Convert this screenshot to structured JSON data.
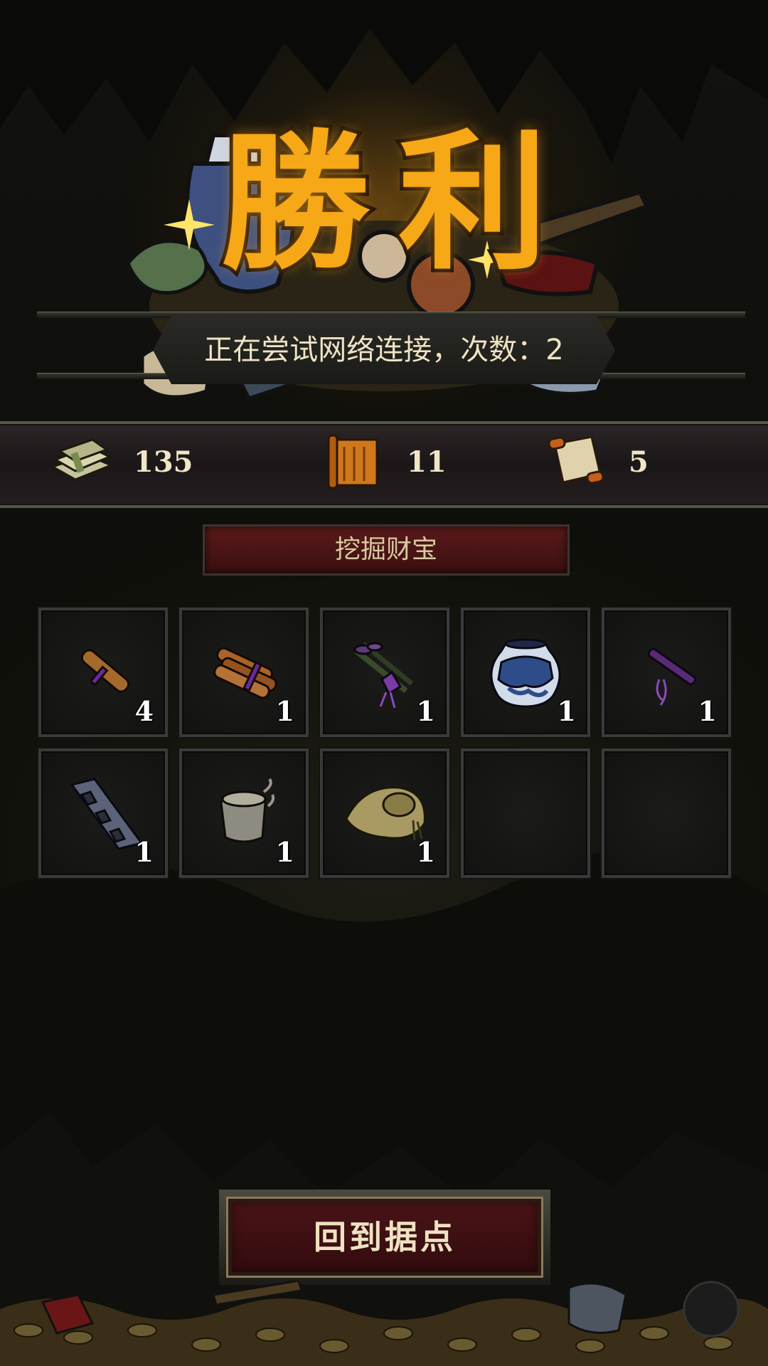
{
  "title": "勝利",
  "network_status": "正在尝试网络连接，次数：2",
  "resources": [
    {
      "icon": "money-icon",
      "value": "135"
    },
    {
      "icon": "scroll-icon",
      "value": "11"
    },
    {
      "icon": "map-icon",
      "value": "5"
    }
  ],
  "section_title": "挖掘财宝",
  "loot": [
    {
      "icon": "wood-bundle-icon",
      "count": "4"
    },
    {
      "icon": "wood-bundles-icon",
      "count": "1"
    },
    {
      "icon": "purple-herb-icon",
      "count": "1"
    },
    {
      "icon": "porcelain-jar-icon",
      "count": "1"
    },
    {
      "icon": "purple-flute-icon",
      "count": "1"
    },
    {
      "icon": "iron-plate-icon",
      "count": "1"
    },
    {
      "icon": "cloth-bag-icon",
      "count": "1"
    },
    {
      "icon": "straw-hat-icon",
      "count": "1"
    },
    {
      "icon": "",
      "count": ""
    },
    {
      "icon": "",
      "count": ""
    }
  ],
  "return_button": "回到据点",
  "colors": {
    "title": "#f7a817",
    "button_bg": "#4a1416",
    "header_bg": "#5a1a1a"
  }
}
